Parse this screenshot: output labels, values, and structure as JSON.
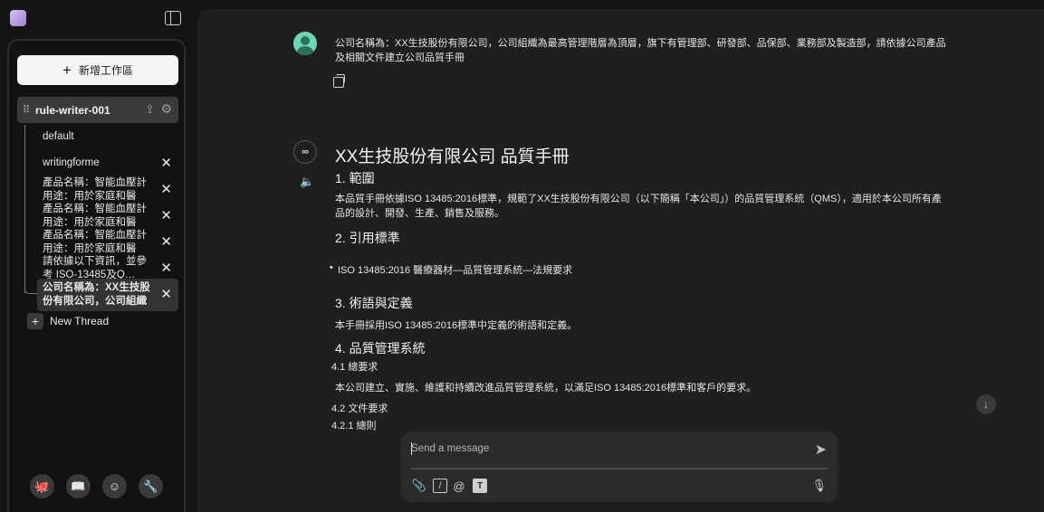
{
  "sidebar": {
    "new_workspace_label": "新增工作區",
    "workspace_name": "rule-writer-001",
    "threads": [
      {
        "label": "default",
        "closable": false
      },
      {
        "label": "writingforme",
        "closable": true
      },
      {
        "label": "產品名稱：智能血壓計 用途：用於家庭和醫療…",
        "closable": true
      },
      {
        "label": "產品名稱：智能血壓計 用途：用於家庭和醫療…",
        "closable": true
      },
      {
        "label": "產品名稱：智能血壓計 用途：用於家庭和醫療…",
        "closable": true
      },
      {
        "label": "請依據以下資訊，並參考 ISO-13485及Q…",
        "closable": true
      },
      {
        "label": "公司名稱為：XX生技股份有限公司，公司組織為…",
        "closable": true
      }
    ],
    "new_thread_label": "New Thread"
  },
  "chat": {
    "user_message": "公司名稱為：XX生技股份有限公司，公司組織為最高管理階層為頂層，旗下有管理部、研發部、品保部、業務部及製造部，請依據公司產品及相關文件建立公司品質手冊",
    "response": {
      "title": "XX生技股份有限公司 品質手冊",
      "section1_heading": "1. 範圍",
      "section1_text": "本品質手冊依據ISO 13485:2016標準，規範了XX生技股份有限公司（以下簡稱「本公司」）的品質管理系統（QMS），適用於本公司所有產品的設計、開發、生產、銷售及服務。",
      "section2_heading": "2. 引用標準",
      "section2_bullet": "ISO 13485:2016 醫療器材—品質管理系統—法規要求",
      "section3_heading": "3. 術語與定義",
      "section3_text": "本手冊採用ISO 13485:2016標準中定義的術語和定義。",
      "section4_heading": "4. 品質管理系統",
      "section4_1": "4.1 總要求",
      "section4_1_text": "本公司建立、實施、維護和持續改進品質管理系統，以滿足ISO 13485:2016標準和客戶的要求。",
      "section4_2": "4.2 文件要求",
      "section4_2_1": "4.2.1 總則"
    }
  },
  "composer": {
    "placeholder": "Send a message"
  }
}
